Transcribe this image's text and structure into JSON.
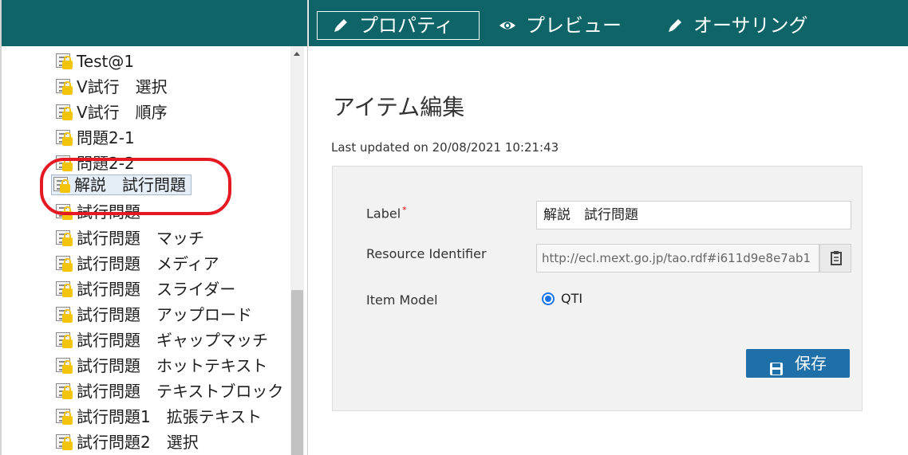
{
  "tabs": {
    "properties": "プロパティ",
    "preview": "プレビュー",
    "authoring": "オーサリング"
  },
  "tree": {
    "items": [
      "Test@1",
      "V試行　選択",
      "V試行　順序",
      "問題2-1",
      "問題2-2",
      "解説　試行問題",
      "試行問題",
      "試行問題　マッチ",
      "試行問題　メディア",
      "試行問題　スライダー",
      "試行問題　アップロード",
      "試行問題　ギャップマッチ",
      "試行問題　ホットテキスト",
      "試行問題　テキストブロック",
      "試行問題1　拡張テキスト",
      "試行問題2　選択"
    ],
    "selected_index": 5
  },
  "main": {
    "title": "アイテム編集",
    "last_updated": "Last updated on 20/08/2021 10:21:43"
  },
  "form": {
    "label_label": "Label",
    "required_mark": "*",
    "label_value": "解説　試行問題",
    "resource_label": "Resource Identifier",
    "resource_value": "http://ecl.mext.go.jp/tao.rdf#i611d9e8e7ab1",
    "item_model_label": "Item Model",
    "item_model_value": "QTI",
    "save_label": "保存"
  },
  "colors": {
    "header_bg": "#0e6466",
    "save_button": "#1f6fa8",
    "highlight_ring": "#e41922",
    "lock": "#f2c40c"
  }
}
